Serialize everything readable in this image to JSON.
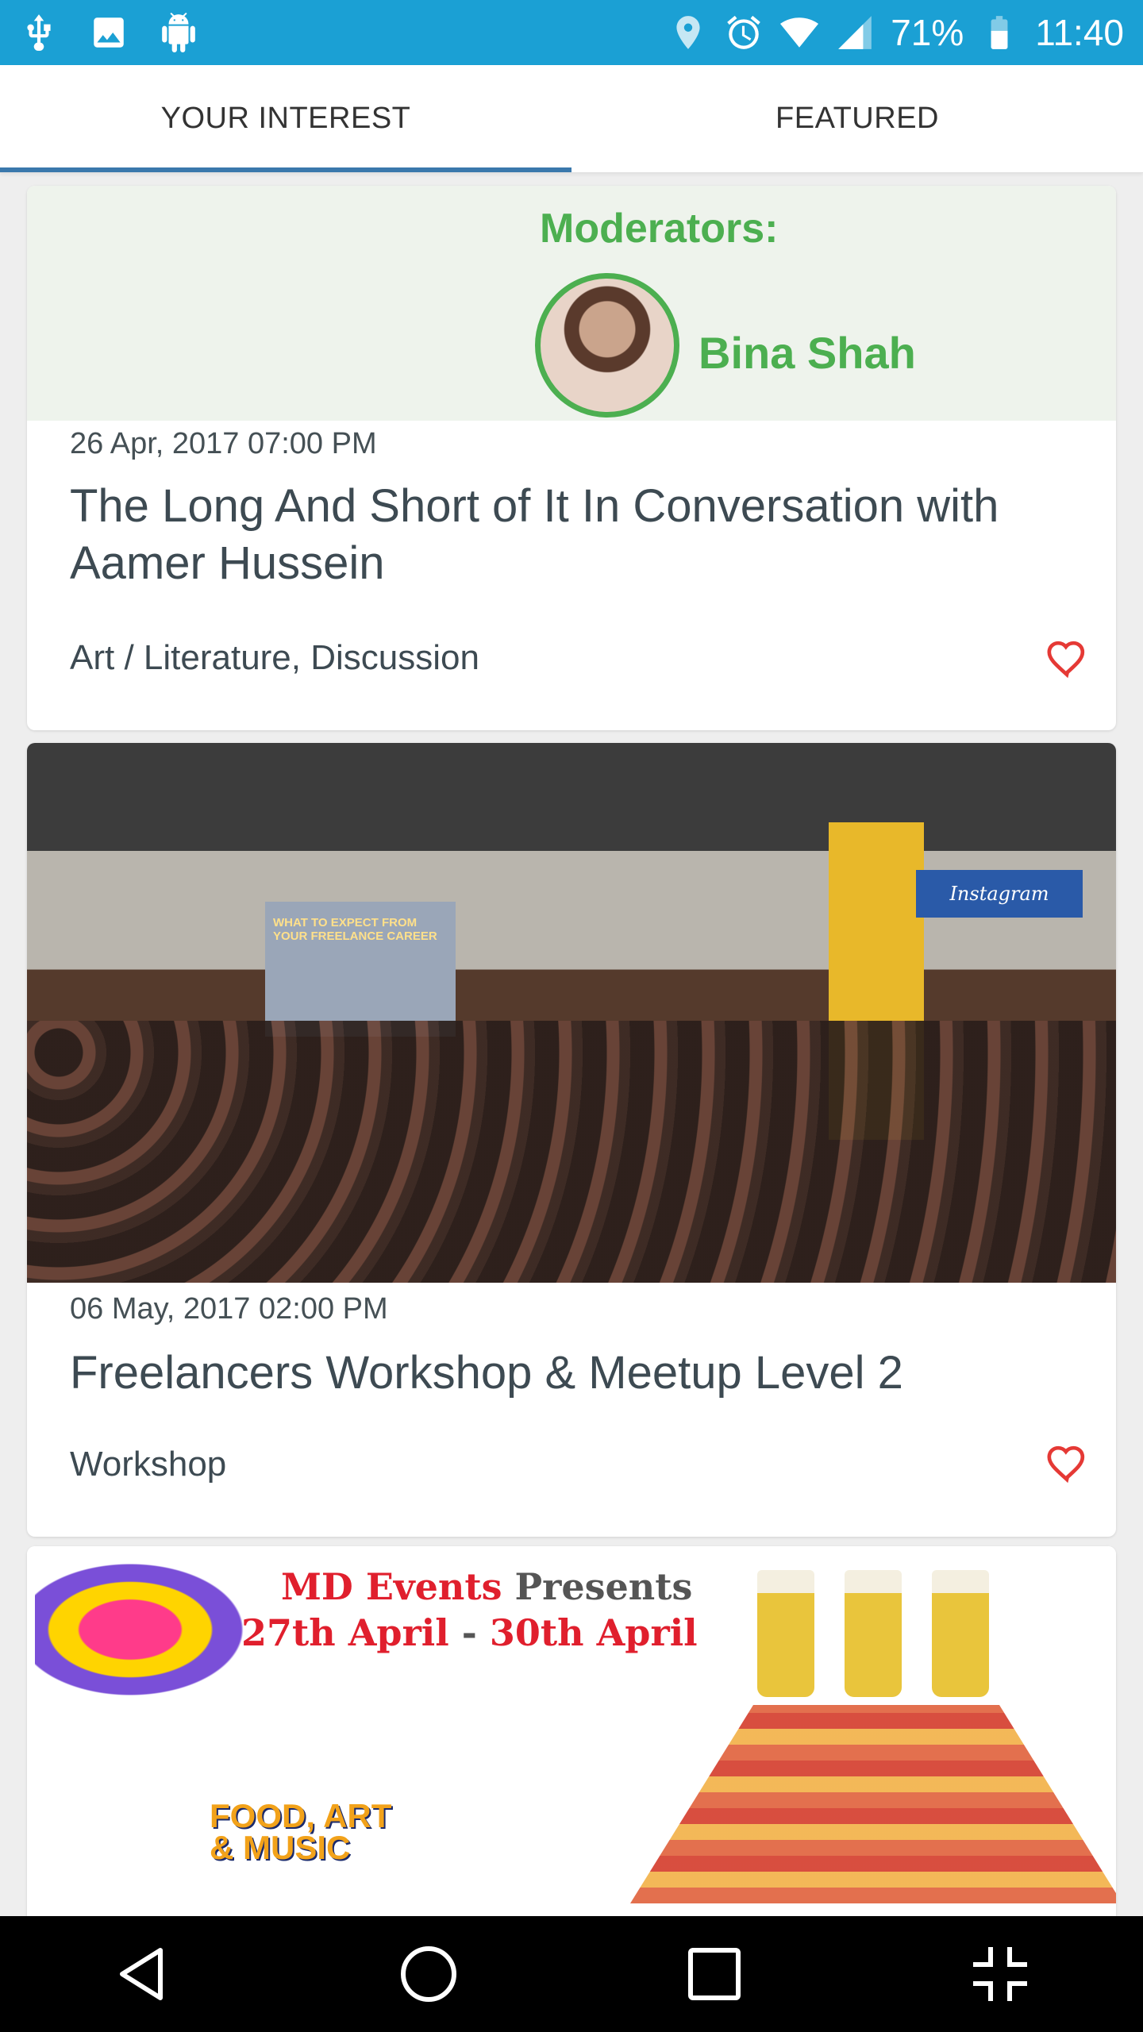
{
  "status_bar": {
    "left_icons": [
      "usb-icon",
      "image-icon",
      "android-debug-icon"
    ],
    "right_icons": [
      "location-icon",
      "alarm-icon",
      "wifi-icon",
      "signal-icon",
      "battery-icon"
    ],
    "battery": "71%",
    "time": "11:40"
  },
  "tabs": [
    {
      "label": "YOUR INTEREST",
      "active": true
    },
    {
      "label": "FEATURED",
      "active": false
    }
  ],
  "cards": [
    {
      "image": {
        "heading": "Moderators:",
        "name": "Bina Shah"
      },
      "date": "26 Apr, 2017 07:00 PM",
      "title": "The Long And Short of It In Conversation with Aamer Hussein",
      "categories": "Art / Literature, Discussion",
      "favorite_icon": "heart-outline-icon"
    },
    {
      "image": {
        "screen_text": "WHAT TO EXPECT FROM YOUR FREELANCE CAREER",
        "sign_text": "Instagram"
      },
      "date": "06 May, 2017 02:00 PM",
      "title": "Freelancers Workshop & Meetup Level 2",
      "categories": "Workshop",
      "favorite_icon": "heart-outline-icon"
    },
    {
      "image": {
        "line1_a": "MD Events",
        "line1_b": " Presents",
        "line2_a": "27th April",
        "line2_b": " - ",
        "line2_c": "30th April",
        "logo_line1": "FOOD, ART",
        "logo_line2": "& MUSIC"
      }
    }
  ],
  "nav_bar": {
    "buttons": [
      "back-icon",
      "home-icon",
      "recents-icon",
      "exit-fullscreen-icon"
    ]
  },
  "colors": {
    "status_bar": "#1ba0d4",
    "tab_indicator": "#3a78ac",
    "heart": "#e53935",
    "text": "#3d4a52"
  }
}
